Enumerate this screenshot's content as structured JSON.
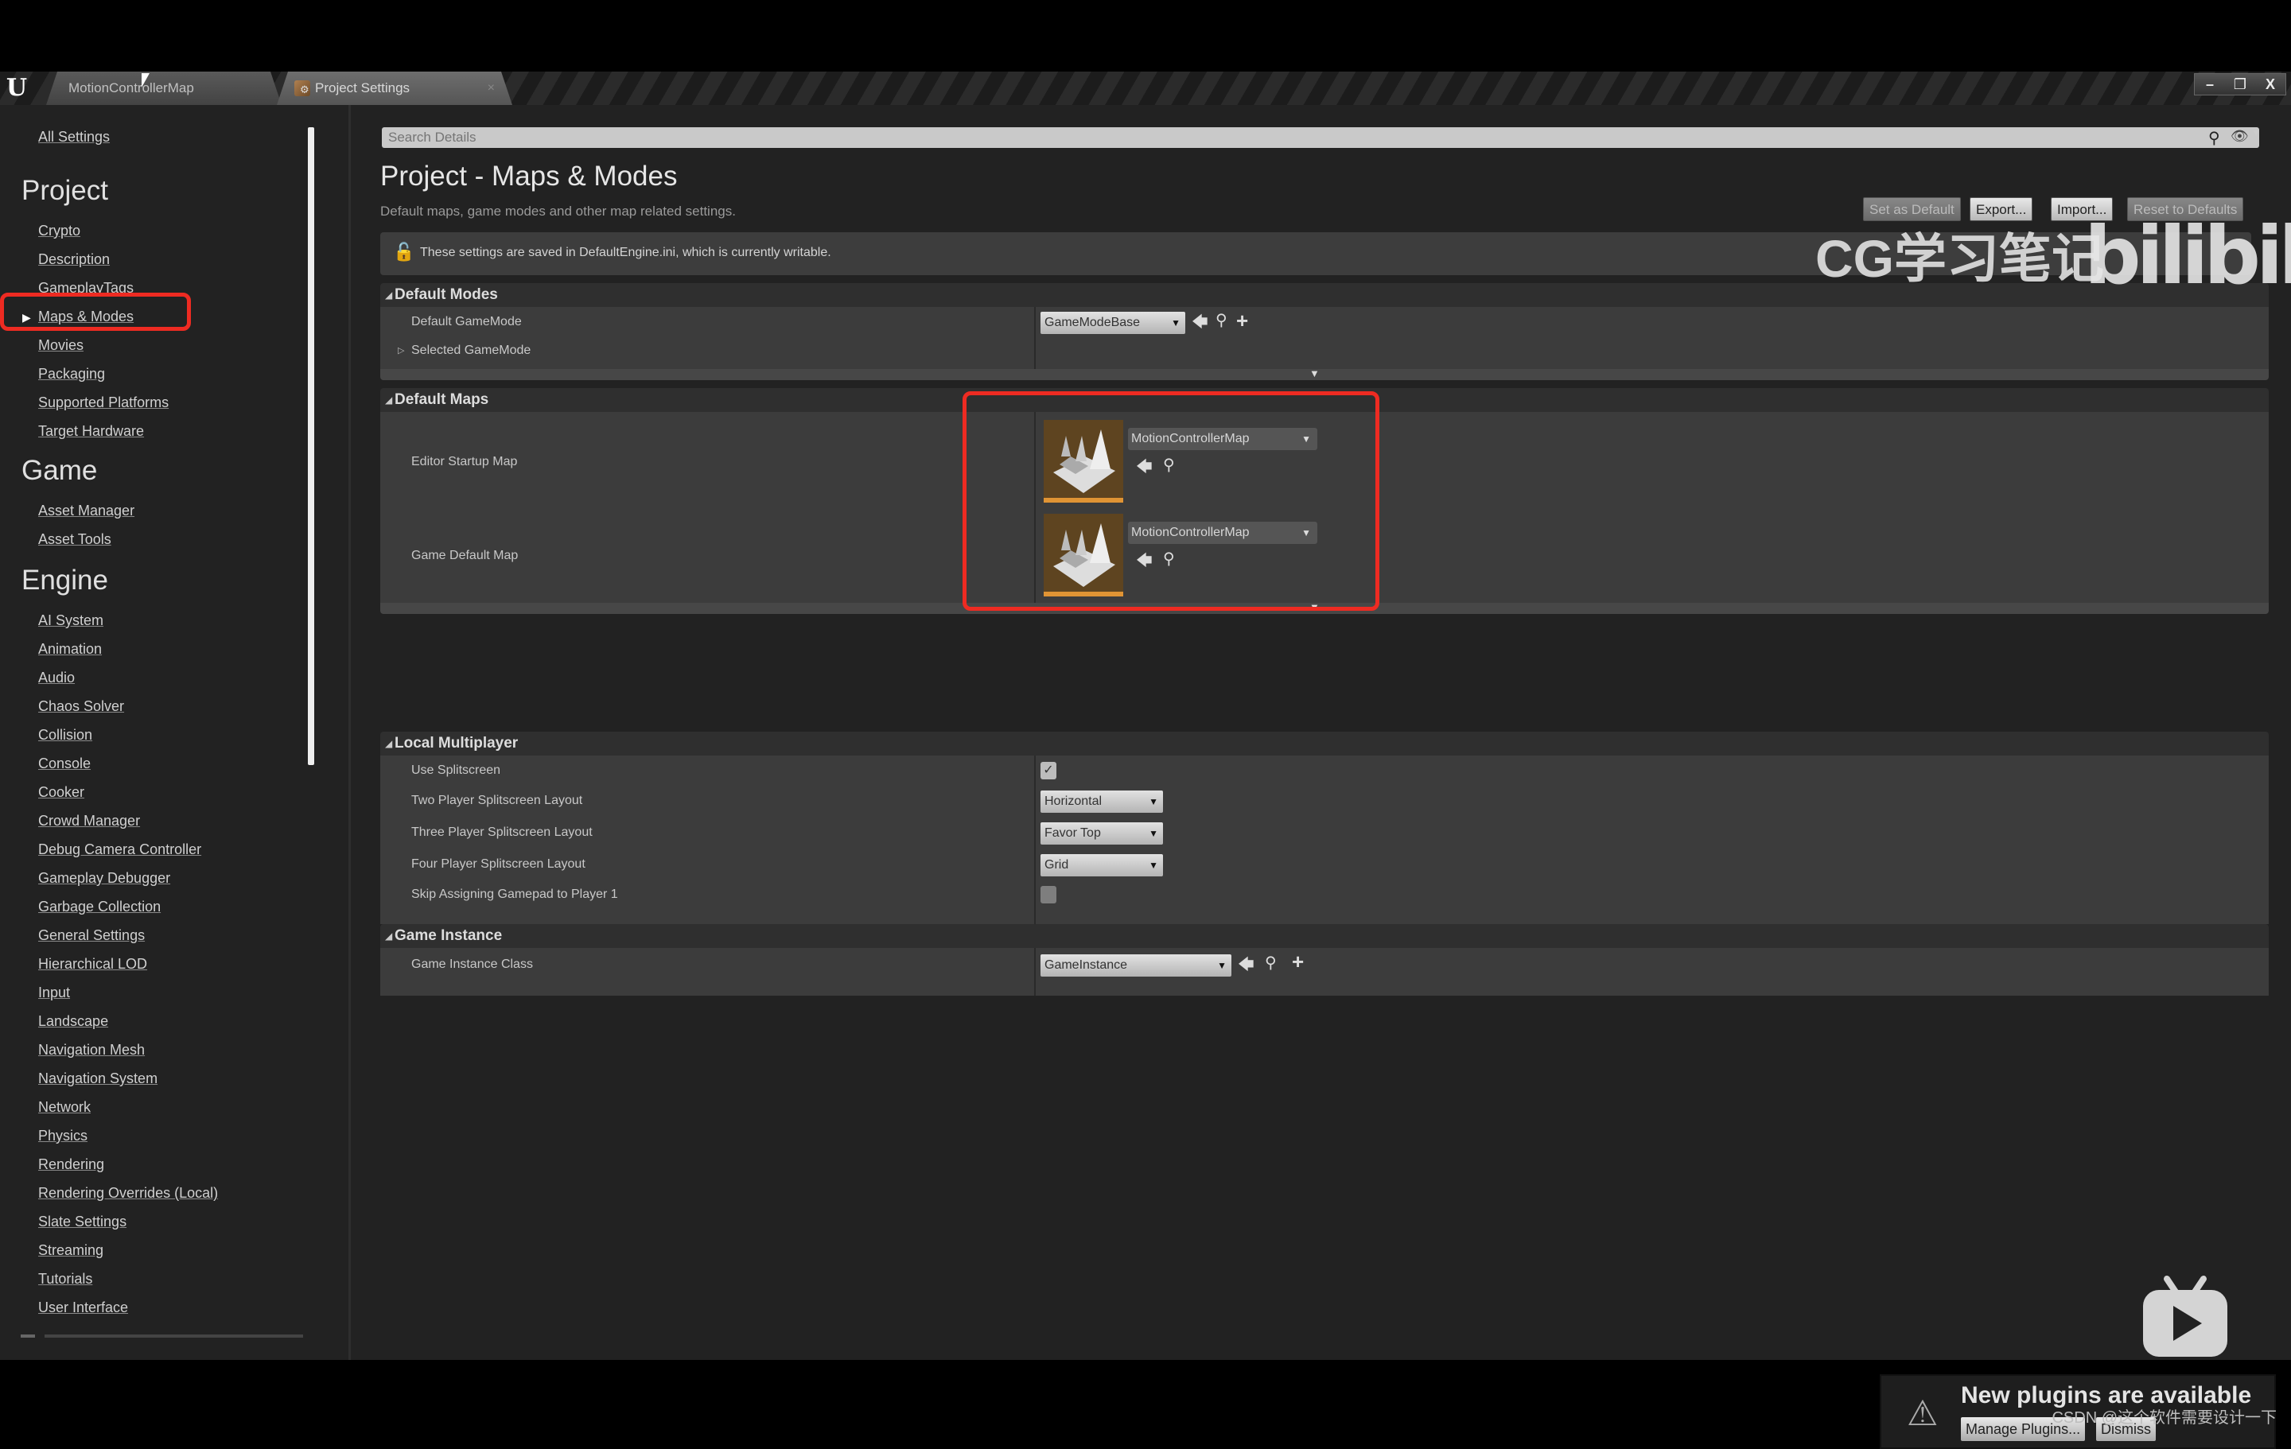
{
  "tabs": {
    "level_tab": "MotionControllerMap",
    "settings_tab": "Project Settings",
    "close_glyph": "×"
  },
  "window_controls": {
    "minimize": "–",
    "restore": "❐",
    "close": "X"
  },
  "sidebar": {
    "all_settings": "All Settings",
    "sections": [
      {
        "title": "Project",
        "items": [
          "Crypto",
          "Description",
          "GameplayTags",
          "Maps & Modes",
          "Movies",
          "Packaging",
          "Supported Platforms",
          "Target Hardware"
        ]
      },
      {
        "title": "Game",
        "items": [
          "Asset Manager",
          "Asset Tools"
        ]
      },
      {
        "title": "Engine",
        "items": [
          "AI System",
          "Animation",
          "Audio",
          "Chaos Solver",
          "Collision",
          "Console",
          "Cooker",
          "Crowd Manager",
          "Debug Camera Controller",
          "Gameplay Debugger",
          "Garbage Collection",
          "General Settings",
          "Hierarchical LOD",
          "Input",
          "Landscape",
          "Navigation Mesh",
          "Navigation System",
          "Network",
          "Physics",
          "Rendering",
          "Rendering Overrides (Local)",
          "Slate Settings",
          "Streaming",
          "Tutorials",
          "User Interface"
        ]
      }
    ],
    "selected": "Maps & Modes"
  },
  "search": {
    "placeholder": "Search Details"
  },
  "header": {
    "title": "Project - Maps & Modes",
    "subtitle": "Default maps, game modes and other map related settings.",
    "buttons": {
      "set_default": "Set as Default",
      "export": "Export...",
      "import": "Import...",
      "reset": "Reset to Defaults"
    },
    "info": "These settings are saved in DefaultEngine.ini, which is currently writable."
  },
  "categories": {
    "default_modes": {
      "title": "Default Modes",
      "default_gamemode_label": "Default GameMode",
      "default_gamemode_value": "GameModeBase",
      "selected_gamemode_label": "Selected GameMode"
    },
    "default_maps": {
      "title": "Default Maps",
      "editor_startup_label": "Editor Startup Map",
      "editor_startup_value": "MotionControllerMap",
      "game_default_label": "Game Default Map",
      "game_default_value": "MotionControllerMap"
    },
    "local_multiplayer": {
      "title": "Local Multiplayer",
      "use_splitscreen_label": "Use Splitscreen",
      "use_splitscreen_checked": true,
      "two_player_label": "Two Player Splitscreen Layout",
      "two_player_value": "Horizontal",
      "three_player_label": "Three Player Splitscreen Layout",
      "three_player_value": "Favor Top",
      "four_player_label": "Four Player Splitscreen Layout",
      "four_player_value": "Grid",
      "skip_gamepad_label": "Skip Assigning Gamepad to Player 1",
      "skip_gamepad_checked": false
    },
    "game_instance": {
      "title": "Game Instance",
      "class_label": "Game Instance Class",
      "class_value": "GameInstance"
    }
  },
  "glyphs": {
    "check": "✓",
    "caret": "▼",
    "back_arrow": "🡄",
    "search": "⚲",
    "plus": "+",
    "tri_open": "◢",
    "tri_closed": "▷",
    "more": "▼",
    "warn": "⚠",
    "lock": "🔓",
    "eye": "👁"
  },
  "notification": {
    "title": "New plugins are available",
    "manage_button": "Manage Plugins...",
    "dismiss_button": "Dismiss"
  },
  "overlay": {
    "watermark": "CG学习笔记",
    "bili_logo": "bilibili",
    "credit": "CSDN @这个软件需要设计一下"
  },
  "colors": {
    "highlight": "#ee2b22",
    "map_thumb_bar": "#e09434",
    "map_thumb_bg": "#5e4420"
  }
}
